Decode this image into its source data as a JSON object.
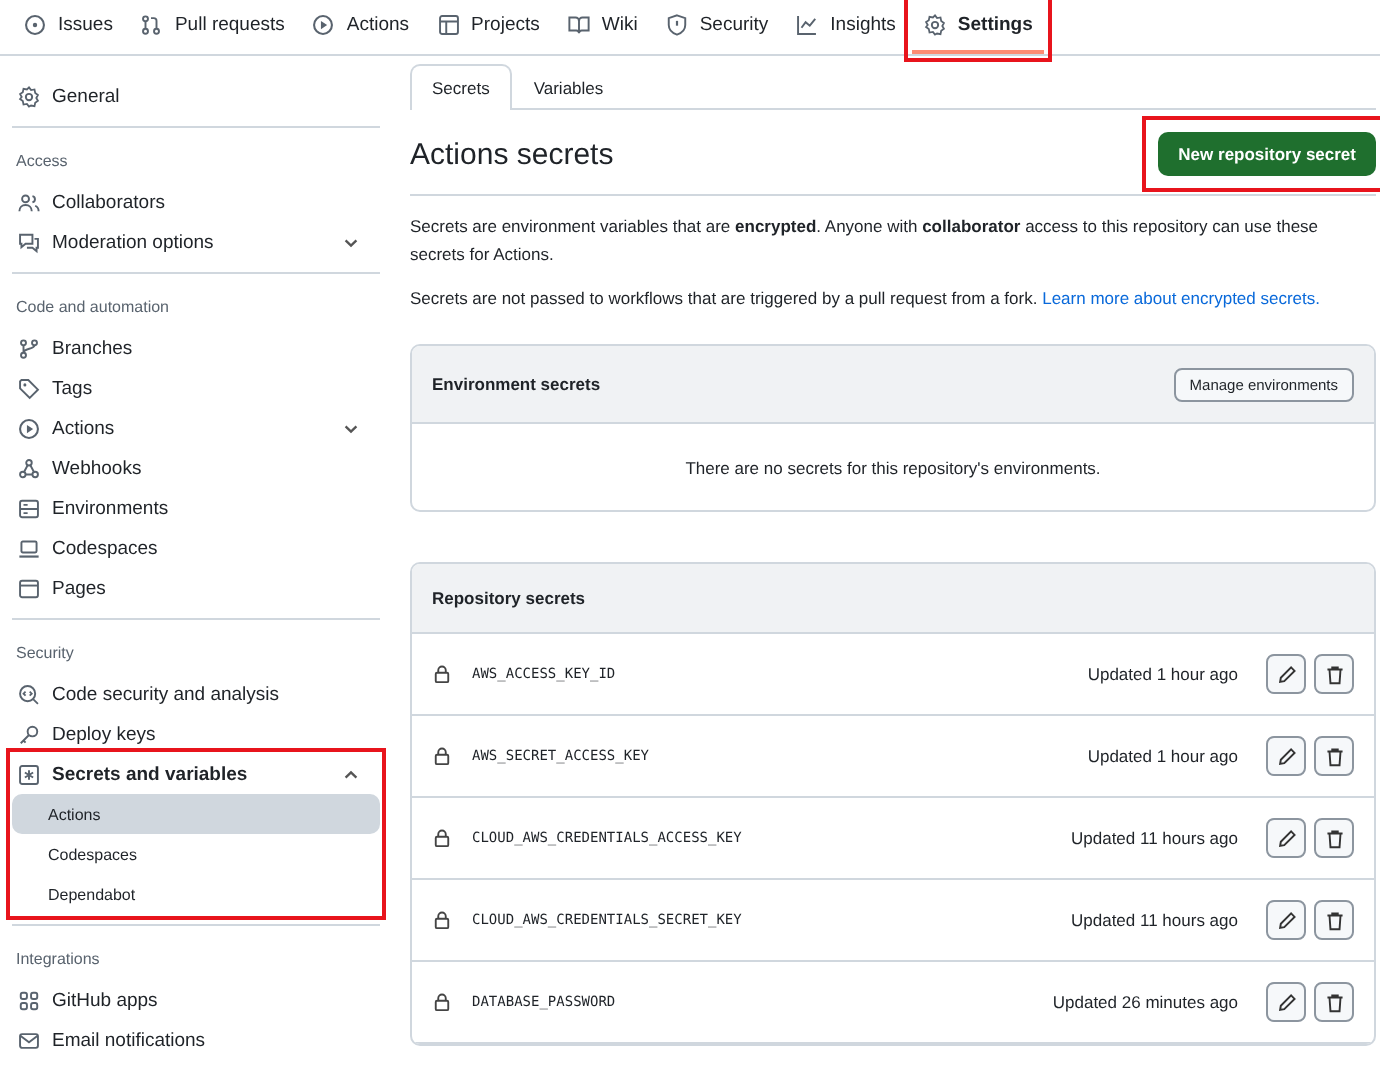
{
  "repo_nav": [
    {
      "label": "Issues",
      "selected": false,
      "highlighted": false
    },
    {
      "label": "Pull requests",
      "selected": false,
      "highlighted": false
    },
    {
      "label": "Actions",
      "selected": false,
      "highlighted": false
    },
    {
      "label": "Projects",
      "selected": false,
      "highlighted": false
    },
    {
      "label": "Wiki",
      "selected": false,
      "highlighted": false
    },
    {
      "label": "Security",
      "selected": false,
      "highlighted": false
    },
    {
      "label": "Insights",
      "selected": false,
      "highlighted": false
    },
    {
      "label": "Settings",
      "selected": true,
      "highlighted": true
    }
  ],
  "sidebar": {
    "sections": [
      {
        "items": [
          {
            "label": "General",
            "selected": false
          }
        ]
      },
      {
        "heading": "Access",
        "items": [
          {
            "label": "Collaborators",
            "selected": false
          },
          {
            "label": "Moderation options",
            "selected": false,
            "expanded": false
          }
        ]
      },
      {
        "heading": "Code and automation",
        "items": [
          {
            "label": "Branches",
            "selected": false
          },
          {
            "label": "Tags",
            "selected": false
          },
          {
            "label": "Actions",
            "selected": false,
            "expanded": false
          },
          {
            "label": "Webhooks",
            "selected": false
          },
          {
            "label": "Environments",
            "selected": false
          },
          {
            "label": "Codespaces",
            "selected": false
          },
          {
            "label": "Pages",
            "selected": false
          }
        ]
      },
      {
        "heading": "Security",
        "items": [
          {
            "label": "Code security and analysis",
            "selected": false
          },
          {
            "label": "Deploy keys",
            "selected": false
          },
          {
            "label": "Secrets and variables",
            "selected": false,
            "expanded": true,
            "highlighted": true,
            "children": [
              {
                "label": "Actions",
                "selected": true
              },
              {
                "label": "Codespaces",
                "selected": false
              },
              {
                "label": "Dependabot",
                "selected": false
              }
            ]
          }
        ]
      },
      {
        "heading": "Integrations",
        "items": [
          {
            "label": "GitHub apps",
            "selected": false
          },
          {
            "label": "Email notifications",
            "selected": false
          }
        ]
      }
    ]
  },
  "tabs": [
    {
      "label": "Secrets",
      "selected": true
    },
    {
      "label": "Variables",
      "selected": false
    }
  ],
  "heading": "Actions secrets",
  "new_button": {
    "label": "New repository secret",
    "highlighted": true
  },
  "description": [
    "Secrets are environment variables that are **encrypted**. Anyone with **collaborator** access to this repository can use these secrets for Actions.",
    "Secrets are not passed to workflows that are triggered by a pull request from a fork."
  ],
  "learn_more_link": "Learn more about encrypted secrets.",
  "environment_secrets": {
    "title": "Environment secrets",
    "button": "Manage environments",
    "empty_message": "There are no secrets for this repository's environments."
  },
  "repository_secrets": {
    "title": "Repository secrets",
    "rows": [
      {
        "name": "AWS_ACCESS_KEY_ID",
        "updated": "Updated 1 hour ago"
      },
      {
        "name": "AWS_SECRET_ACCESS_KEY",
        "updated": "Updated 1 hour ago"
      },
      {
        "name": "CLOUD_AWS_CREDENTIALS_ACCESS_KEY",
        "updated": "Updated 11 hours ago"
      },
      {
        "name": "CLOUD_AWS_CREDENTIALS_SECRET_KEY",
        "updated": "Updated 11 hours ago"
      },
      {
        "name": "DATABASE_PASSWORD",
        "updated": "Updated 26 minutes ago"
      }
    ]
  }
}
